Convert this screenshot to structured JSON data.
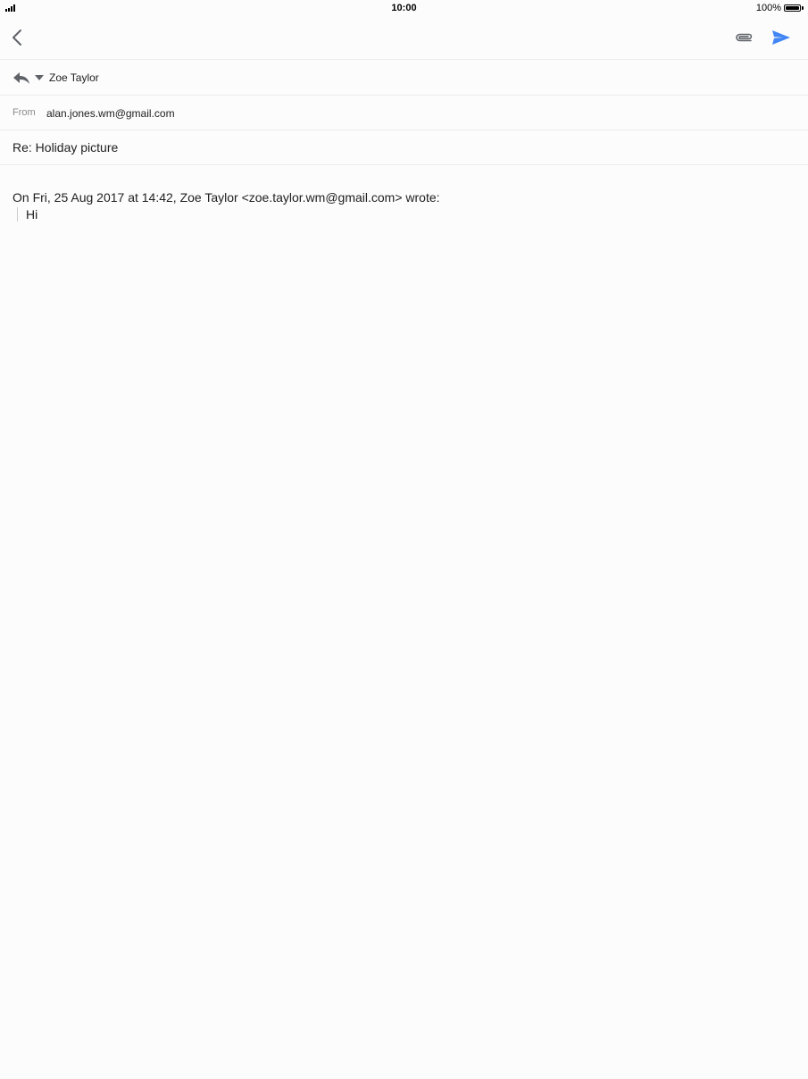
{
  "status_bar": {
    "time": "10:00",
    "battery_percent_label": "100%",
    "battery_level": 1.0
  },
  "toolbar": {
    "back_icon": "chevron-left-icon",
    "attach_icon": "paperclip-icon",
    "send_icon": "send-icon",
    "send_color": "#4285f4"
  },
  "compose": {
    "to": {
      "reply_icon": "reply-icon",
      "dropdown_icon": "triangle-down-icon",
      "name": "Zoe Taylor"
    },
    "from": {
      "label": "From",
      "value": "alan.jones.wm@gmail.com"
    },
    "subject": "Re: Holiday picture",
    "quoted": {
      "header": "On Fri, 25 Aug 2017 at 14:42, Zoe Taylor <zoe.taylor.wm@gmail.com> wrote:",
      "text": "Hi"
    }
  }
}
